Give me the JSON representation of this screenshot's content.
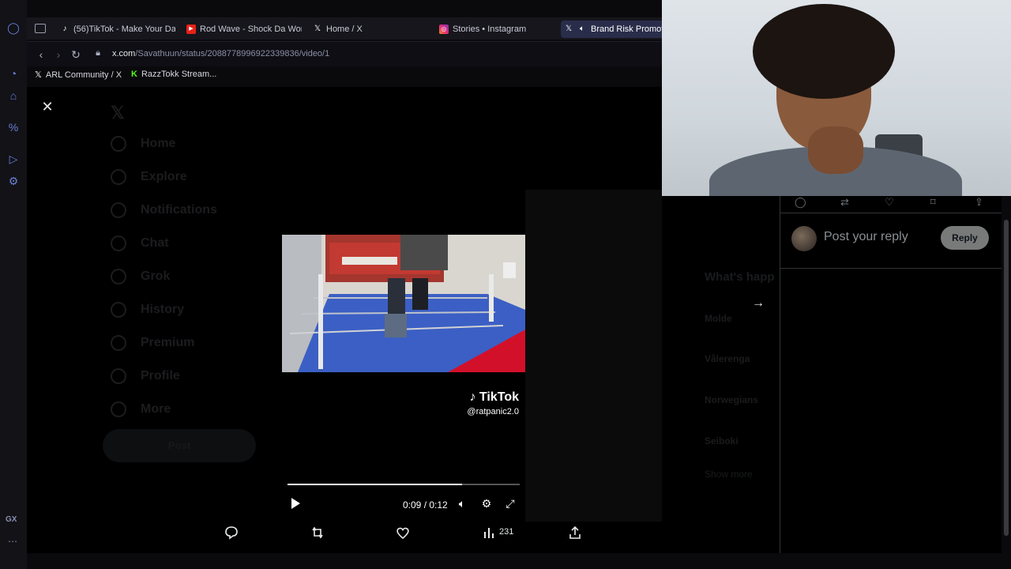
{
  "browser": {
    "tabs": [
      {
        "label": "(56)TikTok - Make Your Day",
        "icon": "tiktok-icon",
        "active": false
      },
      {
        "label": "Rod Wave - Shock Da World",
        "icon": "youtube-icon",
        "active": false
      },
      {
        "label": "Home / X",
        "icon": "x-logo-icon",
        "active": false
      },
      {
        "label": "Stories • Instagram",
        "icon": "instagram-icon",
        "active": false
      },
      {
        "label": "Brand Risk Promoti",
        "icon": "x-logo-icon",
        "active": true
      }
    ],
    "url_host": "x.com",
    "url_path": "/Savathuun/status/2088778996922339836/video/1",
    "bookmarks": [
      {
        "label": "ARL Community / X",
        "icon": "x-logo-icon"
      },
      {
        "label": "RazzTokk Stream...",
        "icon": "kick-icon"
      }
    ]
  },
  "background_nav": {
    "items": [
      "Home",
      "Explore",
      "Notifications",
      "Chat",
      "Grok",
      "History",
      "Premium",
      "Profile",
      "More"
    ],
    "post_label": "Post"
  },
  "background_trends": {
    "heading": "What's happ",
    "items": [
      "Molde",
      "Vålerenga",
      "Norwegians",
      "Seiboki",
      "Show more"
    ]
  },
  "video": {
    "watermark_brand": "TikTok",
    "watermark_handle": "@ratpanic2.0",
    "current_time": "0:09",
    "separator": " / ",
    "duration": "0:12",
    "progress_fraction": 0.75
  },
  "actions": {
    "views": "231"
  },
  "reply": {
    "placeholder": "Post your reply",
    "button_label": "Reply"
  },
  "colors": {
    "accent": "#6b7fd7",
    "x_text": "#e7e9ea",
    "reply_button": "#787a7a"
  }
}
